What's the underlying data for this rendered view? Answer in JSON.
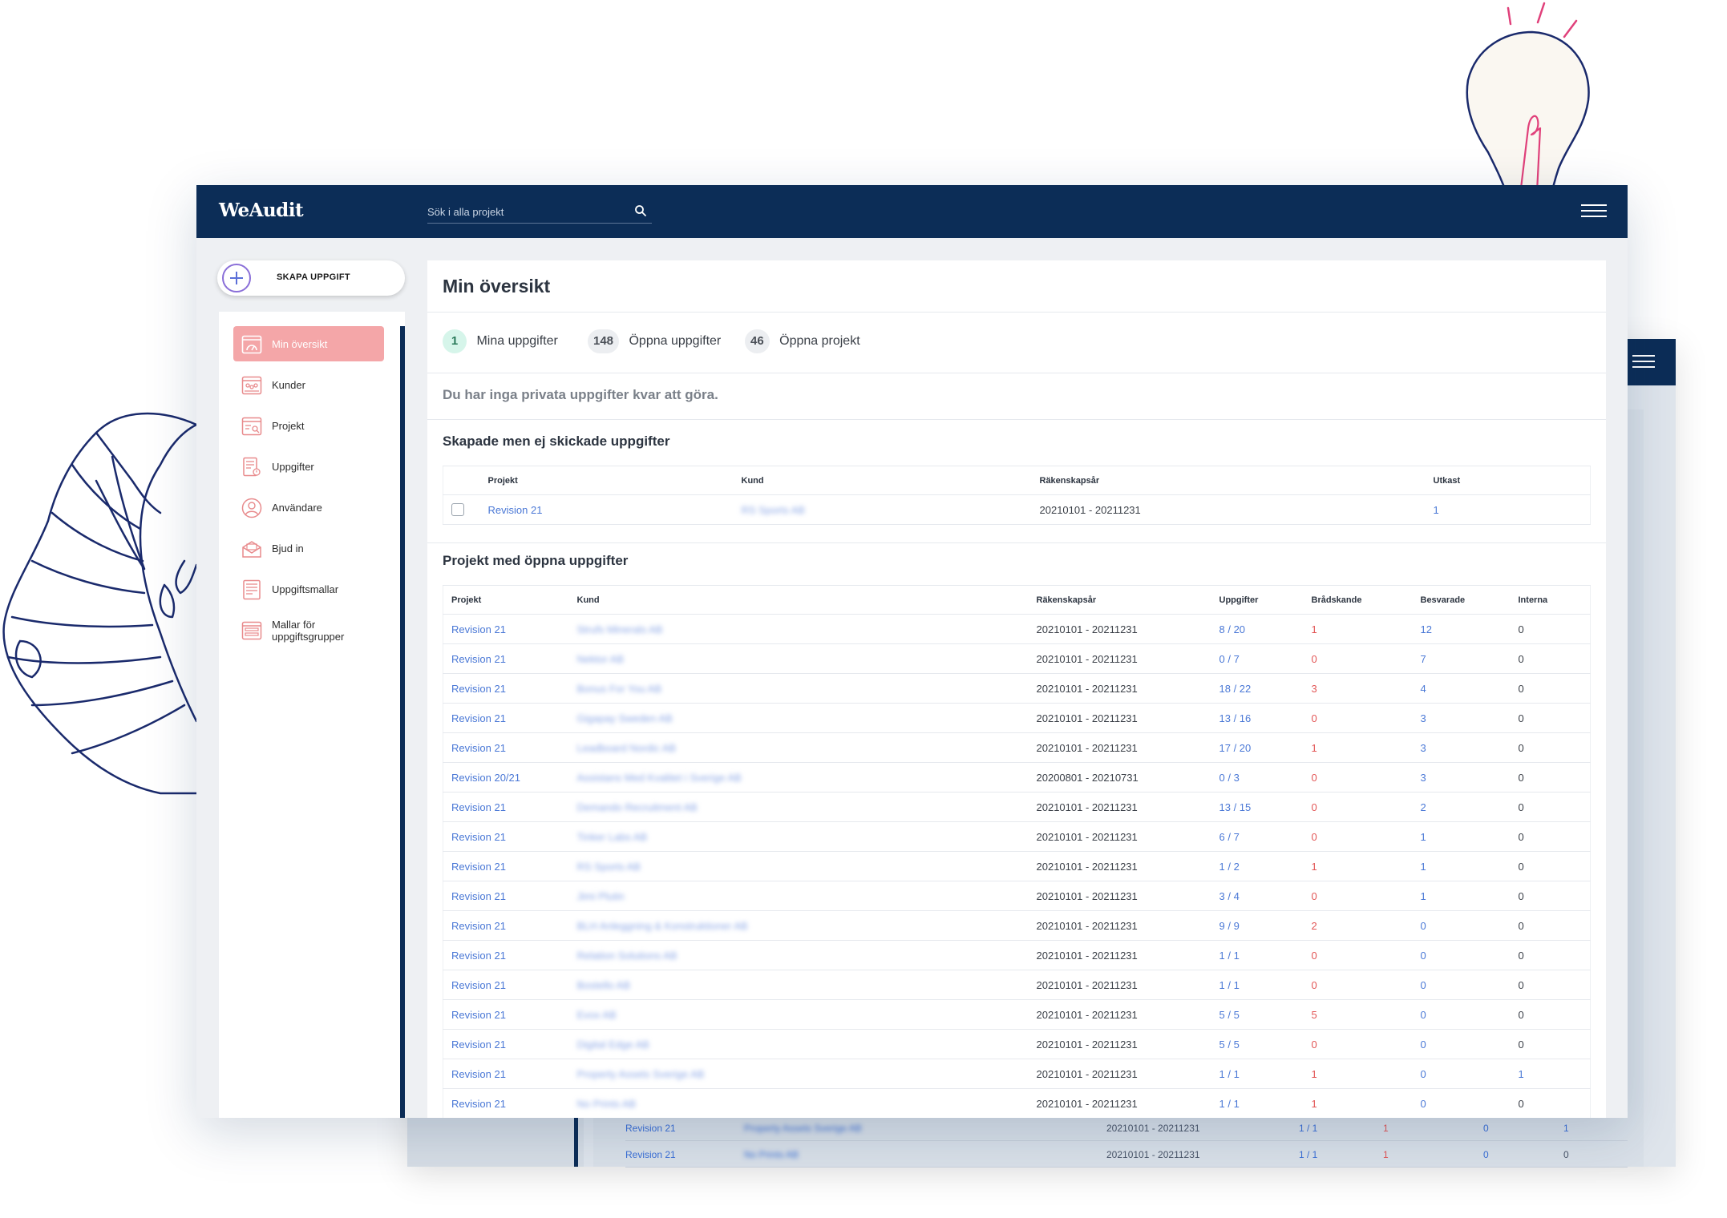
{
  "app": {
    "name": "WeAudit"
  },
  "search": {
    "placeholder": "Sök i alla projekt"
  },
  "create_button": {
    "label": "SKAPA UPPGIFT"
  },
  "sidebar": {
    "items": [
      {
        "label": "Min översikt",
        "icon": "dashboard-icon",
        "active": true
      },
      {
        "label": "Kunder",
        "icon": "customers-icon"
      },
      {
        "label": "Projekt",
        "icon": "projects-icon"
      },
      {
        "label": "Uppgifter",
        "icon": "tasks-icon"
      },
      {
        "label": "Användare",
        "icon": "user-icon"
      },
      {
        "label": "Bjud in",
        "icon": "invite-icon"
      },
      {
        "label": "Uppgiftsmallar",
        "icon": "task-templates-icon"
      },
      {
        "label": "Mallar för uppgiftsgrupper",
        "icon": "group-templates-icon"
      }
    ]
  },
  "main": {
    "title": "Min översikt",
    "stats": [
      {
        "count": "1",
        "label": "Mina uppgifter"
      },
      {
        "count": "148",
        "label": "Öppna uppgifter"
      },
      {
        "count": "46",
        "label": "Öppna projekt"
      }
    ],
    "empty_message": "Du har inga privata uppgifter kvar att göra.",
    "drafts": {
      "title": "Skapade men ej skickade uppgifter",
      "headers": [
        "Projekt",
        "Kund",
        "Räkenskapsår",
        "Utkast"
      ],
      "rows": [
        {
          "project": "Revision 21",
          "customer": "RS Sports AB",
          "year": "20210101 - 20211231",
          "drafts": "1"
        }
      ]
    },
    "open_projects": {
      "title": "Projekt med öppna uppgifter",
      "headers": [
        "Projekt",
        "Kund",
        "Räkenskapsår",
        "Uppgifter",
        "Brådskande",
        "Besvarade",
        "Interna"
      ],
      "rows": [
        {
          "project": "Revision 21",
          "customer": "Strufs Minerals AB",
          "year": "20210101 - 20211231",
          "tasks": "8 / 20",
          "urgent": "1",
          "answered": "12",
          "internal": "0"
        },
        {
          "project": "Revision 21",
          "customer": "Nektor AB",
          "year": "20210101 - 20211231",
          "tasks": "0 / 7",
          "urgent": "0",
          "answered": "7",
          "internal": "0"
        },
        {
          "project": "Revision 21",
          "customer": "Bonus For You AB",
          "year": "20210101 - 20211231",
          "tasks": "18 / 22",
          "urgent": "3",
          "answered": "4",
          "internal": "0"
        },
        {
          "project": "Revision 21",
          "customer": "Gigapay Sweden AB",
          "year": "20210101 - 20211231",
          "tasks": "13 / 16",
          "urgent": "0",
          "answered": "3",
          "internal": "0"
        },
        {
          "project": "Revision 21",
          "customer": "Leadboard Nordic AB",
          "year": "20210101 - 20211231",
          "tasks": "17 / 20",
          "urgent": "1",
          "answered": "3",
          "internal": "0"
        },
        {
          "project": "Revision 20/21",
          "customer": "Assistans Med Kvalitet i Sverige AB",
          "year": "20200801 - 20210731",
          "tasks": "0 / 3",
          "urgent": "0",
          "answered": "3",
          "internal": "0"
        },
        {
          "project": "Revision 21",
          "customer": "Demando Recruitment AB",
          "year": "20210101 - 20211231",
          "tasks": "13 / 15",
          "urgent": "0",
          "answered": "2",
          "internal": "0"
        },
        {
          "project": "Revision 21",
          "customer": "Tinker Labs AB",
          "year": "20210101 - 20211231",
          "tasks": "6 / 7",
          "urgent": "0",
          "answered": "1",
          "internal": "0"
        },
        {
          "project": "Revision 21",
          "customer": "RS Sports AB",
          "year": "20210101 - 20211231",
          "tasks": "1 / 2",
          "urgent": "1",
          "answered": "1",
          "internal": "0"
        },
        {
          "project": "Revision 21",
          "customer": "Jimi Plutin",
          "year": "20210101 - 20211231",
          "tasks": "3 / 4",
          "urgent": "0",
          "answered": "1",
          "internal": "0"
        },
        {
          "project": "Revision 21",
          "customer": "BLH Anleggning & Konstruktioner AB",
          "year": "20210101 - 20211231",
          "tasks": "9 / 9",
          "urgent": "2",
          "answered": "0",
          "internal": "0"
        },
        {
          "project": "Revision 21",
          "customer": "Relation Solutions AB",
          "year": "20210101 - 20211231",
          "tasks": "1 / 1",
          "urgent": "0",
          "answered": "0",
          "internal": "0"
        },
        {
          "project": "Revision 21",
          "customer": "Bostello AB",
          "year": "20210101 - 20211231",
          "tasks": "1 / 1",
          "urgent": "0",
          "answered": "0",
          "internal": "0"
        },
        {
          "project": "Revision 21",
          "customer": "Evox AB",
          "year": "20210101 - 20211231",
          "tasks": "5 / 5",
          "urgent": "5",
          "answered": "0",
          "internal": "0"
        },
        {
          "project": "Revision 21",
          "customer": "Digital Edge AB",
          "year": "20210101 - 20211231",
          "tasks": "5 / 5",
          "urgent": "0",
          "answered": "0",
          "internal": "0"
        },
        {
          "project": "Revision 21",
          "customer": "Property Assets Sverige AB",
          "year": "20210101 - 20211231",
          "tasks": "1 / 1",
          "urgent": "1",
          "answered": "0",
          "internal": "1"
        },
        {
          "project": "Revision 21",
          "customer": "No Prints AB",
          "year": "20210101 - 20211231",
          "tasks": "1 / 1",
          "urgent": "1",
          "answered": "0",
          "internal": "0"
        }
      ]
    }
  },
  "background_window": {
    "rows": [
      {
        "project": "Revision 21",
        "customer": "Property Assets Sverige AB",
        "year": "20210101 - 20211231",
        "tasks": "1 / 1",
        "urgent": "1",
        "answered": "0",
        "internal": "1"
      },
      {
        "project": "Revision 21",
        "customer": "No Prints AB",
        "year": "20210101 - 20211231",
        "tasks": "1 / 1",
        "urgent": "1",
        "answered": "0",
        "internal": "0"
      }
    ]
  },
  "colors": {
    "header": "#0c2d57",
    "accent_pink": "#f4a6a8",
    "link": "#4a78d6",
    "urgent": "#e25555"
  }
}
